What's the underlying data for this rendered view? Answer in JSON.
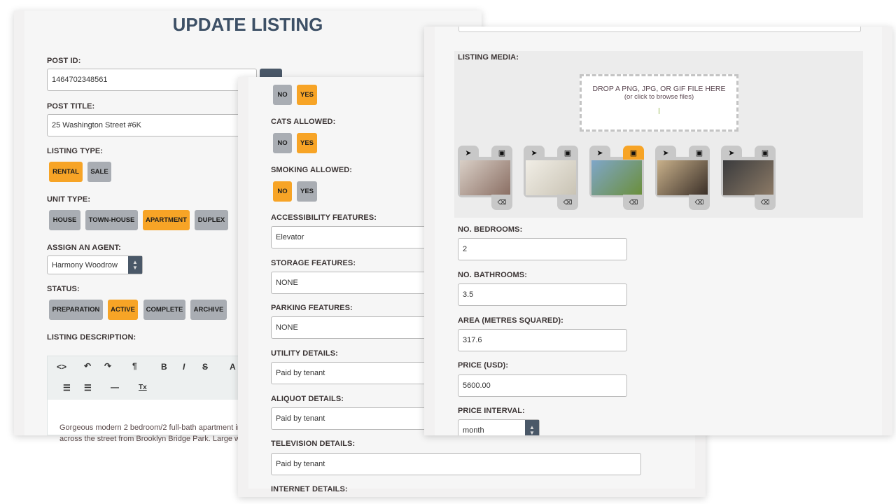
{
  "panel1": {
    "title": "UPDATE LISTING",
    "post_id": {
      "label": "POST ID:",
      "value": "1464702348561"
    },
    "post_title": {
      "label": "POST TITLE:",
      "value": "25 Washington Street #6K"
    },
    "listing_type": {
      "label": "LISTING TYPE:",
      "options": [
        "RENTAL",
        "SALE"
      ],
      "selected": "RENTAL"
    },
    "unit_type": {
      "label": "UNIT TYPE:",
      "options": [
        "HOUSE",
        "TOWN-HOUSE",
        "APARTMENT",
        "DUPLEX"
      ],
      "selected": "APARTMENT"
    },
    "agent": {
      "label": "ASSIGN AN AGENT:",
      "value": "Harmony Woodrow"
    },
    "status": {
      "label": "STATUS:",
      "options": [
        "PREPARATION",
        "ACTIVE",
        "COMPLETE",
        "ARCHIVE"
      ],
      "selected": "ACTIVE"
    },
    "description": {
      "label": "LISTING DESCRIPTION:",
      "lines": [
        "Gorgeous modern 2 bedroom/2 full-bath apartment in",
        "across the street from Brooklyn Bridge Park. Large win"
      ]
    },
    "toolbar": {
      "row1": [
        "<>",
        "↶",
        "↷",
        "¶",
        "B",
        "I",
        "S",
        "A"
      ],
      "row2": [
        "list-ul",
        "list-ol",
        "—",
        "Tx"
      ]
    }
  },
  "panel2": {
    "toggles": [
      {
        "label": "",
        "options": [
          "NO",
          "YES"
        ],
        "selected": "YES"
      },
      {
        "label": "CATS ALLOWED:",
        "options": [
          "NO",
          "YES"
        ],
        "selected": "YES"
      },
      {
        "label": "SMOKING ALLOWED:",
        "options": [
          "NO",
          "YES"
        ],
        "selected": "NO"
      }
    ],
    "fields": [
      {
        "label": "ACCESSIBILITY FEATURES:",
        "value": "Elevator"
      },
      {
        "label": "STORAGE FEATURES:",
        "value": "NONE"
      },
      {
        "label": "PARKING FEATURES:",
        "value": "NONE"
      },
      {
        "label": "UTILITY DETAILS:",
        "value": "Paid by tenant"
      },
      {
        "label": "ALIQUOT DETAILS:",
        "value": "Paid by tenant"
      },
      {
        "label": "TELEVISION DETAILS:",
        "value": "Paid by tenant"
      },
      {
        "label": "INTERNET DETAILS:",
        "value": ""
      }
    ]
  },
  "panel3": {
    "media": {
      "label": "LISTING MEDIA:",
      "drop_title": "DROP A PNG, JPG, OR GIF FILE HERE",
      "drop_sub": "(or click to browse files)",
      "featured_index": 2,
      "thumb_colors": [
        [
          "#d9cfc6",
          "#8a6e63"
        ],
        [
          "#f1eee6",
          "#c9c3b4"
        ],
        [
          "#7fa6c9",
          "#6b8f3a"
        ],
        [
          "#c8b08a",
          "#3a2f28"
        ],
        [
          "#3a3b3d",
          "#8c7a66"
        ]
      ]
    },
    "fields": [
      {
        "label": "NO. BEDROOMS:",
        "value": "2"
      },
      {
        "label": "NO. BATHROOMS:",
        "value": "3.5"
      },
      {
        "label": "AREA (METRES SQUARED):",
        "value": "317.6"
      },
      {
        "label": "PRICE (USD):",
        "value": "5600.00"
      }
    ],
    "price_interval": {
      "label": "PRICE INTERVAL:",
      "value": "month"
    }
  },
  "colors": {
    "accent": "#f7a426",
    "inactive": "#a9adb3",
    "dark": "#4a5868",
    "title": "#3d5066"
  }
}
